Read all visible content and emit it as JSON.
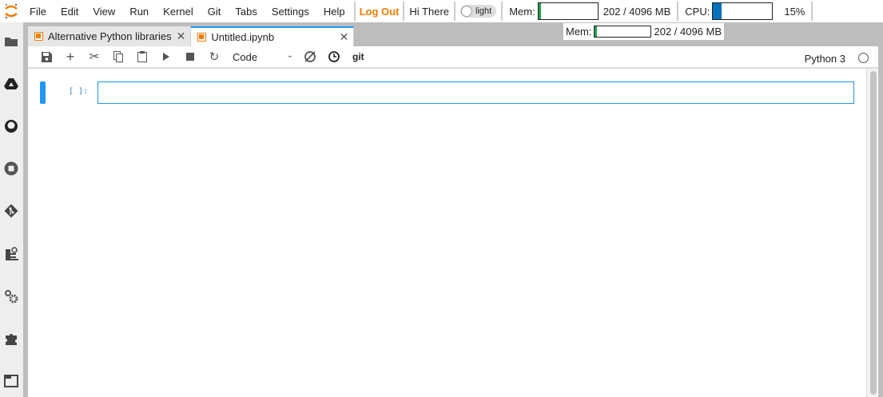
{
  "menubar": {
    "items": [
      "File",
      "Edit",
      "View",
      "Run",
      "Kernel",
      "Git",
      "Tabs",
      "Settings",
      "Help"
    ],
    "logout": "Log Out",
    "greeting": "Hi There",
    "theme_toggle": "light"
  },
  "resources": {
    "mem_label": "Mem:",
    "mem_value": "202 / 4096 MB",
    "mem_fraction": 0.049,
    "mem_color": "#22a24b",
    "cpu_label": "CPU:",
    "cpu_value": "15%",
    "cpu_fraction": 0.15,
    "cpu_color": "#0070b8"
  },
  "tooltip": {
    "mem_label": "Mem:",
    "mem_value": "202 / 4096 MB"
  },
  "sidebar": {
    "icons": [
      "folder-icon",
      "google-drive-icon",
      "github-icon",
      "stop-circle-icon",
      "git-icon",
      "property-inspector-icon",
      "settings-gears-icon",
      "extension-puzzle-icon",
      "tabs-window-icon"
    ]
  },
  "tabs": [
    {
      "label": "Alternative Python libraries",
      "active": false
    },
    {
      "label": "Untitled.ipynb",
      "active": true
    }
  ],
  "toolbar": {
    "cell_type": "Code",
    "git": "git",
    "kernel": "Python 3"
  },
  "cell": {
    "prompt": "[ ]:",
    "content": ""
  },
  "colors": {
    "accent": "#2196f3",
    "brand": "#f57c00"
  }
}
